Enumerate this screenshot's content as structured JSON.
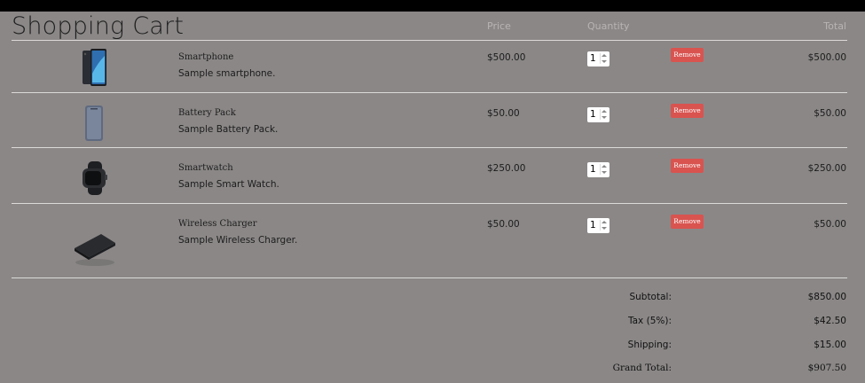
{
  "page": {
    "title": "Shopping Cart"
  },
  "columns": {
    "price": "Price",
    "quantity": "Quantity",
    "total": "Total"
  },
  "items": [
    {
      "name": "Smartphone",
      "description": "Sample smartphone.",
      "price": "$500.00",
      "quantity": "1",
      "remove_label": "Remove",
      "total": "$500.00",
      "image": "smartphone-image"
    },
    {
      "name": "Battery Pack",
      "description": "Sample Battery Pack.",
      "price": "$50.00",
      "quantity": "1",
      "remove_label": "Remove",
      "total": "$50.00",
      "image": "battery-pack-image"
    },
    {
      "name": "Smartwatch",
      "description": "Sample Smart Watch.",
      "price": "$250.00",
      "quantity": "1",
      "remove_label": "Remove",
      "total": "$250.00",
      "image": "smartwatch-image"
    },
    {
      "name": "Wireless Charger",
      "description": "Sample Wireless Charger.",
      "price": "$50.00",
      "quantity": "1",
      "remove_label": "Remove",
      "total": "$50.00",
      "image": "wireless-charger-image"
    }
  ],
  "summary": {
    "subtotal_label": "Subtotal:",
    "subtotal_value": "$850.00",
    "tax_label": "Tax (5%):",
    "tax_value": "$42.50",
    "shipping_label": "Shipping:",
    "shipping_value": "$15.00",
    "grand_total_label": "Grand Total:",
    "grand_total_value": "$907.50"
  },
  "colors": {
    "background": "#8b8787",
    "remove_button": "#d9534f",
    "divider": "#dcd9d9"
  }
}
